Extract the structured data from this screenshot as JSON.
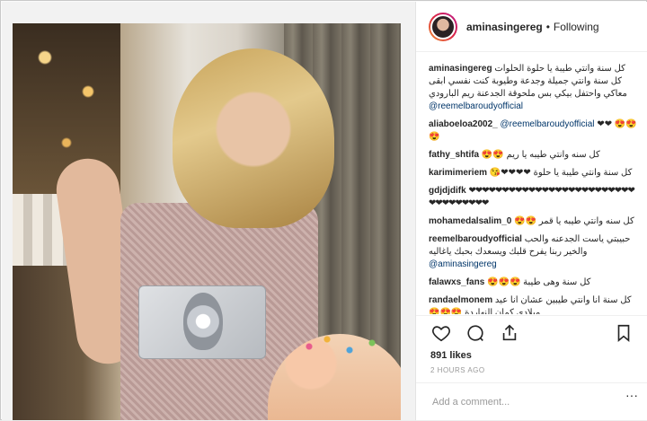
{
  "post": {
    "username": "aminasingereg",
    "separator": "•",
    "follow_status": "Following"
  },
  "comments": [
    {
      "user": "aminasingereg",
      "text": "كل سنة وانتي طيبة يا حلوة الحلوات كل سنة وانتي جميلة وجدعة وطيوبة كنت نفسي ابقى معاكي واحتفل بيكي بس ملحوقة الجدعنة ريم البارودي",
      "mention": "@reemelbaroudyofficial"
    },
    {
      "user": "aliaboeloa2002_",
      "text": "",
      "mention": "@reemelbaroudyofficial",
      "suffix": "❤❤ 😍😍😍"
    },
    {
      "user": "fathy_shtifa",
      "text": "كل سنه وانتي طيبه يا ريم 😍😍",
      "mention": "",
      "suffix": ""
    },
    {
      "user": "karimimeriem",
      "text": "كل سنة وانتي طيبة يا حلوة ❤❤❤❤😘",
      "mention": "",
      "suffix": ""
    },
    {
      "user": "gdjdjdifk",
      "text": "",
      "mention": "",
      "suffix": "❤❤❤❤❤❤❤❤❤❤❤❤❤❤❤❤❤❤❤❤❤❤❤❤❤❤❤❤❤❤❤❤❤❤"
    },
    {
      "user": "mohamedalsalim_0",
      "text": "كل سنه وانتي طيبه يا قمر 😍😍",
      "mention": "",
      "suffix": ""
    },
    {
      "user": "reemelbaroudyofficial",
      "text": "حبيبتي ياست الجدعنه والحب والخير ربنا يفرح قلبك ويسعدك بحبك ياغاليه",
      "mention": "@aminasingereg",
      "suffix": ""
    },
    {
      "user": "falawxs_fans",
      "text": "كل سنة وهى طيبة 😍😍😍",
      "mention": "",
      "suffix": ""
    },
    {
      "user": "randaelmonem",
      "text": "كل سنة انا وانتي طيبين عشان انا عيد ميلادى كمان النهاردة 😍😍😍",
      "mention": "",
      "suffix": ""
    }
  ],
  "actions": {
    "likes": "891 likes",
    "time": "2 HOURS AGO",
    "like_icon": "heart-icon",
    "comment_icon": "comment-icon",
    "share_icon": "share-icon",
    "save_icon": "bookmark-icon"
  },
  "add_comment": {
    "placeholder": "Add a comment...",
    "more": "···"
  }
}
